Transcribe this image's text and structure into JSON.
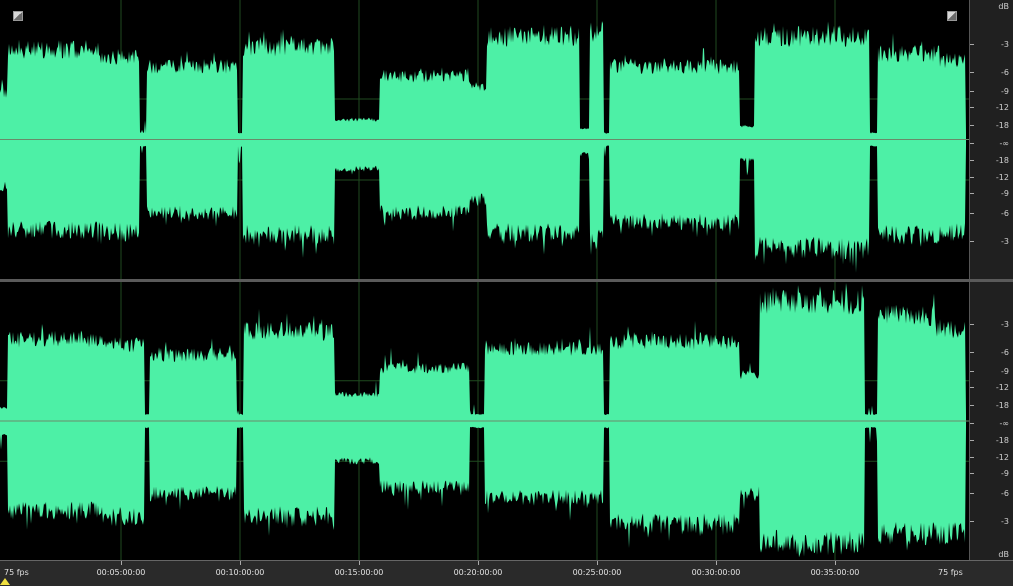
{
  "colors": {
    "waveform": "#4df0a6",
    "background": "#000000",
    "grid": "#1f4a1f",
    "centerline": "#6a8a6a"
  },
  "db_ruler": {
    "unit_label": "dB",
    "labels": [
      "-3",
      "-6",
      "-9",
      "-12",
      "-18",
      "-∞",
      "-18",
      "-12",
      "-9",
      "-6",
      "-3"
    ]
  },
  "timeline": {
    "fps_left": "75 fps",
    "fps_right": "75 fps",
    "labels": [
      "00:05:00:00",
      "00:10:00:00",
      "00:15:00:00",
      "00:20:00:00",
      "00:25:00:00",
      "00:30:00:00",
      "00:35:00:00"
    ]
  },
  "icons": {
    "corner_left": "maximize-corner-icon",
    "corner_right": "maximize-corner-icon"
  }
}
